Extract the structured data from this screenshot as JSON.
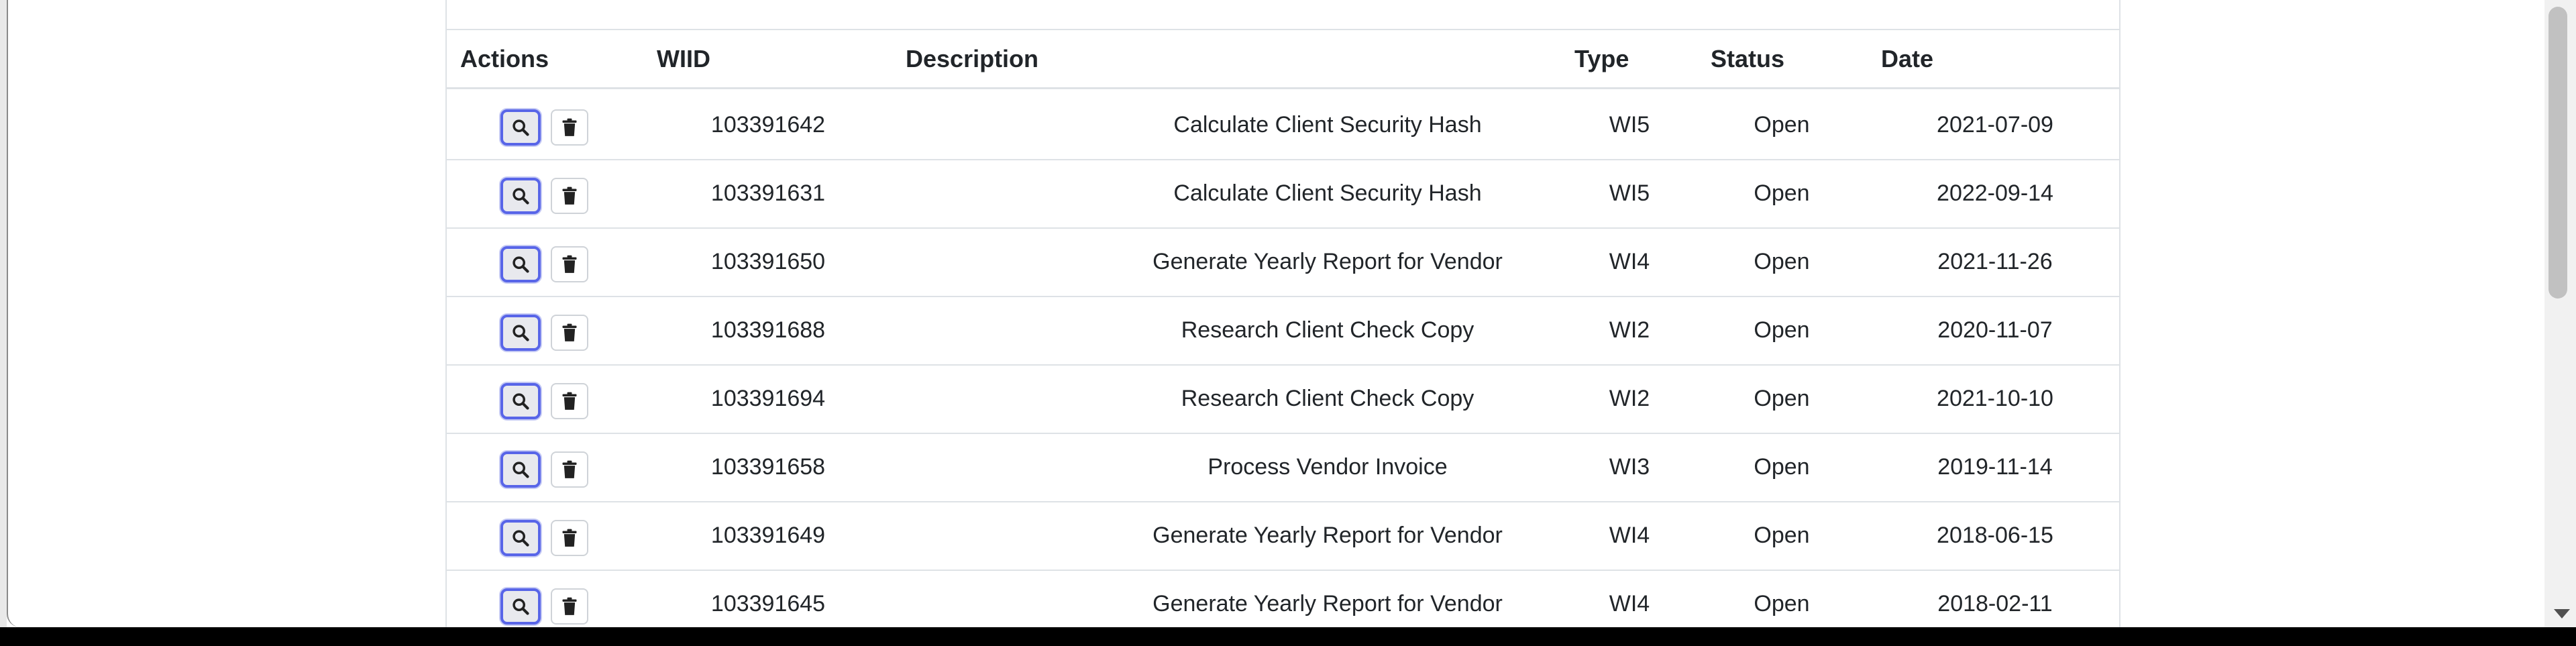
{
  "table": {
    "headers": {
      "actions": "Actions",
      "wiid": "WIID",
      "description": "Description",
      "type": "Type",
      "status": "Status",
      "date": "Date"
    },
    "rows": [
      {
        "wiid": "103391642",
        "description": "Calculate Client Security Hash",
        "type": "WI5",
        "status": "Open",
        "date": "2021-07-09"
      },
      {
        "wiid": "103391631",
        "description": "Calculate Client Security Hash",
        "type": "WI5",
        "status": "Open",
        "date": "2022-09-14"
      },
      {
        "wiid": "103391650",
        "description": "Generate Yearly Report for Vendor",
        "type": "WI4",
        "status": "Open",
        "date": "2021-11-26"
      },
      {
        "wiid": "103391688",
        "description": "Research Client Check Copy",
        "type": "WI2",
        "status": "Open",
        "date": "2020-11-07"
      },
      {
        "wiid": "103391694",
        "description": "Research Client Check Copy",
        "type": "WI2",
        "status": "Open",
        "date": "2021-10-10"
      },
      {
        "wiid": "103391658",
        "description": "Process Vendor Invoice",
        "type": "WI3",
        "status": "Open",
        "date": "2019-11-14"
      },
      {
        "wiid": "103391649",
        "description": "Generate Yearly Report for Vendor",
        "type": "WI4",
        "status": "Open",
        "date": "2018-06-15"
      },
      {
        "wiid": "103391645",
        "description": "Generate Yearly Report for Vendor",
        "type": "WI4",
        "status": "Open",
        "date": "2018-02-11"
      }
    ]
  },
  "icons": {
    "view": "search-icon",
    "delete": "trash-icon"
  },
  "colors": {
    "view_button_border": "#5865e8",
    "text": "#212529",
    "grid_line": "#dee2e6"
  }
}
